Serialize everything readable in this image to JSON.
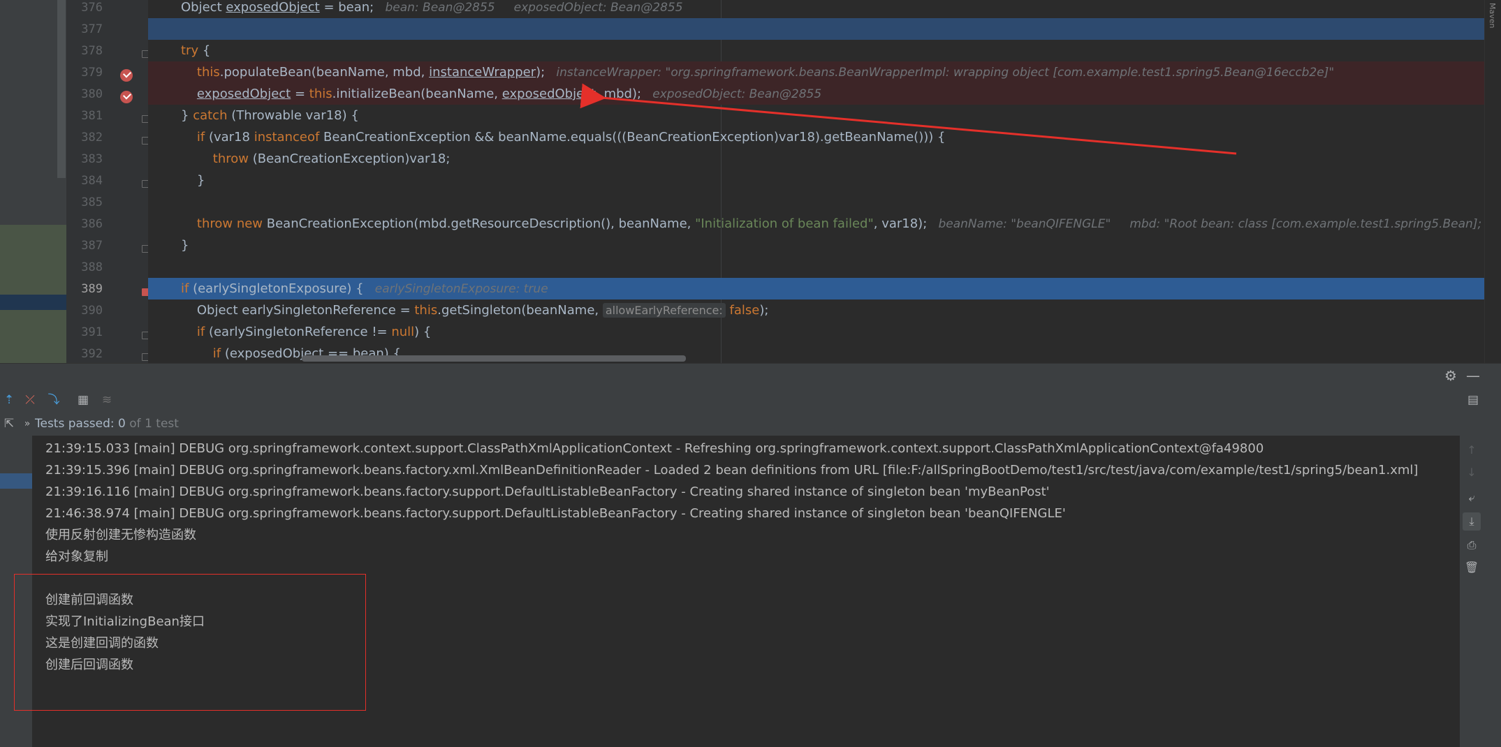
{
  "editor": {
    "lines": [
      {
        "n": "376",
        "parts": [
          {
            "t": "Object ",
            "c": ""
          },
          {
            "t": "exposedObject",
            "c": "und"
          },
          {
            "t": " = bean;",
            "c": ""
          },
          {
            "t": "   bean: Bean@2855     exposedObject: Bean@2855",
            "c": "hint"
          }
        ]
      },
      {
        "n": "377",
        "parts": []
      },
      {
        "n": "378",
        "parts": [
          {
            "t": "try",
            "c": "kw"
          },
          {
            "t": " {",
            "c": ""
          }
        ]
      },
      {
        "n": "379",
        "parts": [
          {
            "t": "    ",
            "c": ""
          },
          {
            "t": "this",
            "c": "kw"
          },
          {
            "t": ".populateBean(beanName, mbd, ",
            "c": ""
          },
          {
            "t": "instanceWrapper",
            "c": "und"
          },
          {
            "t": ");",
            "c": ""
          },
          {
            "t": "   instanceWrapper: \"org.springframework.beans.BeanWrapperImpl: wrapping object [com.example.test1.spring5.Bean@16eccb2e]\"",
            "c": "hint"
          }
        ]
      },
      {
        "n": "380",
        "parts": [
          {
            "t": "    ",
            "c": ""
          },
          {
            "t": "exposedObject",
            "c": "und"
          },
          {
            "t": " = ",
            "c": ""
          },
          {
            "t": "this",
            "c": "kw"
          },
          {
            "t": ".initializeBean(beanName, ",
            "c": ""
          },
          {
            "t": "exposedObject",
            "c": "und"
          },
          {
            "t": ", mbd);",
            "c": ""
          },
          {
            "t": "   exposedObject: Bean@2855",
            "c": "hint"
          }
        ]
      },
      {
        "n": "381",
        "parts": [
          {
            "t": "} ",
            "c": ""
          },
          {
            "t": "catch",
            "c": "kw"
          },
          {
            "t": " (Throwable var18) {",
            "c": ""
          }
        ]
      },
      {
        "n": "382",
        "parts": [
          {
            "t": "    ",
            "c": ""
          },
          {
            "t": "if",
            "c": "kw"
          },
          {
            "t": " (var18 ",
            "c": ""
          },
          {
            "t": "instanceof",
            "c": "kw"
          },
          {
            "t": " BeanCreationException && beanName.equals(((BeanCreationException)var18).getBeanName())) {",
            "c": ""
          }
        ]
      },
      {
        "n": "383",
        "parts": [
          {
            "t": "        ",
            "c": ""
          },
          {
            "t": "throw",
            "c": "kw"
          },
          {
            "t": " (BeanCreationException)var18;",
            "c": ""
          }
        ]
      },
      {
        "n": "384",
        "parts": [
          {
            "t": "    }",
            "c": ""
          }
        ]
      },
      {
        "n": "385",
        "parts": []
      },
      {
        "n": "386",
        "parts": [
          {
            "t": "    ",
            "c": ""
          },
          {
            "t": "throw new",
            "c": "kw"
          },
          {
            "t": " BeanCreationException(mbd.getResourceDescription(), beanName, ",
            "c": ""
          },
          {
            "t": "\"Initialization of bean failed\"",
            "c": "str"
          },
          {
            "t": ", var18);",
            "c": ""
          },
          {
            "t": "   beanName: \"beanQIFENGLE\"     mbd: \"Root bean: class [com.example.test1.spring5.Bean]; scope=singleton; abstract=false\"",
            "c": "hint"
          }
        ]
      },
      {
        "n": "387",
        "parts": [
          {
            "t": "}",
            "c": ""
          }
        ]
      },
      {
        "n": "388",
        "parts": []
      },
      {
        "n": "389",
        "parts": [
          {
            "t": "if",
            "c": "kw"
          },
          {
            "t": " (earlySingletonExposure) {",
            "c": ""
          },
          {
            "t": "   earlySingletonExposure: true",
            "c": "hint"
          }
        ]
      },
      {
        "n": "390",
        "parts": [
          {
            "t": "    Object earlySingletonReference = ",
            "c": ""
          },
          {
            "t": "this",
            "c": "kw"
          },
          {
            "t": ".getSingleton(beanName, ",
            "c": ""
          },
          {
            "t": "allowEarlyReference:",
            "c": "pill"
          },
          {
            "t": " ",
            "c": ""
          },
          {
            "t": "false",
            "c": "kw"
          },
          {
            "t": ");",
            "c": ""
          }
        ]
      },
      {
        "n": "391",
        "parts": [
          {
            "t": "    ",
            "c": ""
          },
          {
            "t": "if",
            "c": "kw"
          },
          {
            "t": " (earlySingletonReference != ",
            "c": ""
          },
          {
            "t": "null",
            "c": "kw"
          },
          {
            "t": ") {",
            "c": ""
          }
        ]
      },
      {
        "n": "392",
        "parts": [
          {
            "t": "        ",
            "c": ""
          },
          {
            "t": "if",
            "c": "kw"
          },
          {
            "t": " (exposedObject == bean) {",
            "c": ""
          }
        ]
      }
    ]
  },
  "side_panel": {
    "label": "Maven"
  },
  "test_status": {
    "label": "Tests passed:",
    "passed": "0",
    "suffix": "of 1 test"
  },
  "console": {
    "lines": [
      "21:39:15.033 [main] DEBUG org.springframework.context.support.ClassPathXmlApplicationContext - Refreshing org.springframework.context.support.ClassPathXmlApplicationContext@fa49800",
      "21:39:15.396 [main] DEBUG org.springframework.beans.factory.xml.XmlBeanDefinitionReader - Loaded 2 bean definitions from URL [file:F:/allSpringBootDemo/test1/src/test/java/com/example/test1/spring5/bean1.xml]",
      "21:39:16.116 [main] DEBUG org.springframework.beans.factory.support.DefaultListableBeanFactory - Creating shared instance of singleton bean 'myBeanPost'",
      "21:46:38.974 [main] DEBUG org.springframework.beans.factory.support.DefaultListableBeanFactory - Creating shared instance of singleton bean 'beanQIFENGLE'",
      "使用反射创建无惨构造函数",
      "给对象复制",
      "",
      "创建前回调函数",
      "实现了InitializingBean接口",
      "这是创建回调的函数",
      "创建后回调函数"
    ]
  },
  "icons": {
    "gear": "gear-icon",
    "minimize": "minimize-icon",
    "colors": {
      "keyword": "#cc7832",
      "string": "#6a8759",
      "breakpoint": "#c75450",
      "selection": "#2e5c94",
      "arrow": "#e5302a"
    }
  }
}
